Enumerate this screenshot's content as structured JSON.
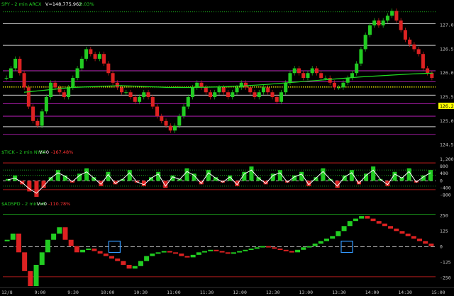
{
  "colors": {
    "background": "#000000",
    "up": "#22cc22",
    "down": "#dd2222",
    "grid": "#ffffff",
    "magenta": "#cc22cc",
    "ma_line": "#22dd22",
    "yellow_dotted": "#ffff00",
    "tick_text": "#c8c8c8",
    "title_green": "#22cc22",
    "title_red": "#ff3333",
    "highlight_box": "#3399ff"
  },
  "chart_data": [
    {
      "type": "candlestick",
      "panel": "price",
      "header": {
        "symbol": "SPY - 2 min  ARCX",
        "volume": "V=148,775,962",
        "change": "0.03%"
      },
      "y_ticks": [
        "127.00",
        "126.50",
        "126.00",
        "125.50",
        "125.00",
        "124.50"
      ],
      "ylim": [
        124.42,
        127.38
      ],
      "current_price": "126.20",
      "reference_lines": {
        "white": [
          127.03,
          126.58,
          126.05,
          125.54,
          124.88
        ],
        "magenta": [
          126.05,
          125.82,
          125.36,
          125.1,
          124.72
        ],
        "yellow_dotted": 125.71,
        "green_dotted_top": 127.28
      },
      "bars": [
        125.9,
        126.1,
        126.3,
        126.0,
        125.7,
        125.3,
        125.0,
        124.9,
        125.2,
        125.5,
        125.8,
        125.7,
        125.6,
        125.5,
        125.7,
        125.9,
        126.1,
        126.3,
        126.5,
        126.4,
        126.3,
        126.4,
        126.2,
        126.0,
        125.8,
        125.7,
        125.6,
        125.6,
        125.5,
        125.4,
        125.5,
        125.6,
        125.5,
        125.3,
        125.1,
        125.0,
        124.9,
        124.8,
        124.9,
        125.1,
        125.3,
        125.5,
        125.7,
        125.8,
        125.7,
        125.6,
        125.5,
        125.6,
        125.7,
        125.6,
        125.5,
        125.6,
        125.7,
        125.8,
        125.7,
        125.6,
        125.5,
        125.6,
        125.7,
        125.6,
        125.5,
        125.4,
        125.6,
        125.8,
        126.0,
        126.1,
        126.0,
        125.9,
        126.0,
        126.1,
        126.0,
        125.9,
        125.9,
        125.8,
        125.7,
        125.7,
        125.8,
        125.9,
        126.0,
        126.2,
        126.5,
        126.8,
        127.0,
        127.1,
        127.0,
        127.1,
        127.2,
        127.3,
        127.1,
        126.9,
        126.7,
        126.6,
        126.5,
        126.4,
        126.1,
        126.0,
        125.9
      ],
      "moving_average": [
        125.6,
        125.65,
        125.7,
        125.72,
        125.74,
        125.72,
        125.7,
        125.7,
        125.71,
        125.73,
        125.76,
        125.8,
        125.84,
        125.88,
        125.92,
        125.95,
        125.98,
        126.0
      ]
    },
    {
      "type": "line",
      "panel": "tick",
      "header": {
        "symbol": "$TICK - 2 min  NYSE",
        "volume": "V=0",
        "change": "-167.48%"
      },
      "y_ticks": [
        "1,200",
        "800",
        "400",
        "0",
        "-400",
        "-800"
      ],
      "ylim": [
        -1100,
        1400
      ],
      "reference_lines": {
        "red": [
          1000,
          -500
        ],
        "green_dotted": [
          600,
          300,
          -300
        ],
        "white_dashed": 0
      },
      "bars": [
        100,
        300,
        -200,
        -600,
        -900,
        -400,
        200,
        600,
        300,
        -100,
        400,
        700,
        200,
        -300,
        500,
        -200,
        100,
        600,
        -100,
        -300,
        200,
        500,
        -400,
        300,
        100,
        700,
        400,
        -200,
        600,
        200,
        -100,
        300,
        -300,
        500,
        800,
        200,
        -200,
        400,
        600,
        -100,
        300,
        500,
        -300,
        200,
        700,
        100,
        -400,
        300,
        600,
        -200,
        400,
        800,
        100,
        -300,
        500,
        200,
        700,
        -100,
        300,
        600
      ],
      "smoothed": [
        50,
        150,
        -100,
        -450,
        -700,
        -300,
        150,
        450,
        250,
        -50,
        300,
        500,
        150,
        -200,
        350,
        -150,
        80,
        450,
        -60,
        -220,
        150,
        380,
        -300,
        220,
        80,
        520,
        300,
        -150,
        450,
        150,
        -80,
        220,
        -220,
        380,
        600,
        150,
        -150,
        300,
        450,
        -80,
        220,
        380,
        -220,
        150,
        520,
        80,
        -300,
        220,
        450,
        -150,
        300,
        600,
        80,
        -220,
        380,
        150,
        520,
        -80,
        220,
        450
      ]
    },
    {
      "type": "line",
      "panel": "adspd",
      "header": {
        "symbol": "$ADSPD - 2 min  US",
        "volume": "V=0",
        "change": "-110.78%"
      },
      "y_ticks": [
        "250",
        "125",
        "0",
        "-125",
        "-250"
      ],
      "ylim": [
        -320,
        320
      ],
      "reference_lines": {
        "green": [
          260
        ],
        "white_dashed": 0,
        "red": [
          -240
        ]
      },
      "highlight_boxes": [
        {
          "x": 78,
          "y": 0
        },
        {
          "x": 258,
          "y": 0
        }
      ],
      "bars": [
        50,
        100,
        -50,
        -200,
        -320,
        -150,
        -50,
        50,
        100,
        150,
        50,
        0,
        -50,
        -30,
        -20,
        -40,
        -60,
        -80,
        -100,
        -120,
        -150,
        -180,
        -160,
        -120,
        -80,
        -60,
        -50,
        -40,
        -50,
        -60,
        -80,
        -90,
        -70,
        -50,
        -40,
        -30,
        -40,
        -50,
        -60,
        -50,
        -40,
        -30,
        -20,
        -10,
        0,
        -10,
        -20,
        -30,
        -40,
        -50,
        -30,
        -10,
        0,
        20,
        40,
        60,
        80,
        120,
        160,
        200,
        220,
        240,
        220,
        200,
        180,
        160,
        140,
        120,
        100,
        80,
        60,
        40,
        20,
        0
      ]
    }
  ],
  "x_axis": {
    "labels": [
      "12/8",
      "9:00",
      "9:30",
      "10:00",
      "10:30",
      "11:00",
      "11:30",
      "12:00",
      "12:30",
      "13:00",
      "13:30",
      "14:00",
      "14:30",
      "15:00"
    ]
  }
}
